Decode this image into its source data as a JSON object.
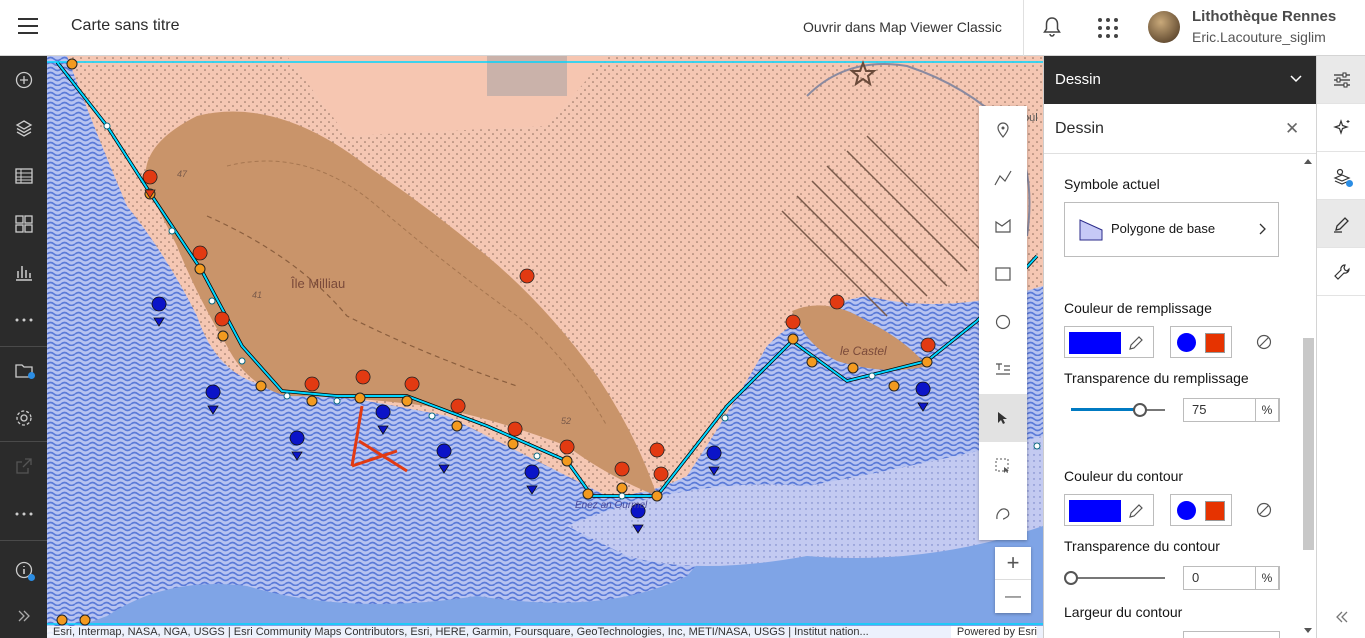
{
  "header": {
    "title": "Carte sans titre",
    "open_classic": "Ouvrir dans Map Viewer Classic",
    "user_name": "Lithothèque Rennes",
    "user_login": "Eric.Lacouture_siglim"
  },
  "left_toolbar": {
    "items": [
      "add-icon",
      "layers-icon",
      "table-icon",
      "basemap-icon",
      "chart-icon",
      "more-icon",
      "map-properties-icon",
      "settings-icon",
      "share-icon",
      "more-icon",
      "info-icon",
      "expand-icon"
    ]
  },
  "map": {
    "labels": {
      "island": "Île Milliau",
      "castel": "le Castel",
      "beach": "Enez an Ourmel",
      "elev1": "47",
      "elev2": "41",
      "elev3": "52",
      "top_right": "oul"
    },
    "attribution": "Esri, Intermap, NASA, NGA, USGS | Esri Community Maps Contributors, Esri, HERE, Garmin, Foursquare, GeoTechnologies, Inc, METI/NASA, USGS | Institut nation...",
    "powered_by": "Powered by Esri",
    "colors": {
      "water": "#7fa4e6",
      "land": "#f4c7b3",
      "relief": "#c9946a",
      "polygon_outline": "#00d5ff",
      "marker_red": "#e23a12",
      "marker_blue": "#0b14c8"
    }
  },
  "draw_toolbar": {
    "tools": [
      "point-icon",
      "polyline-icon",
      "polygon-icon",
      "rectangle-icon",
      "circle-icon",
      "text-icon",
      "select-icon",
      "lasso-select-icon",
      "freehand-icon"
    ],
    "active": "select-icon"
  },
  "zoom": {
    "in": "+",
    "out": "—"
  },
  "panel": {
    "header_title": "Dessin",
    "sub_title": "Dessin",
    "current_symbol_label": "Symbole actuel",
    "symbol_name": "Polygone de base",
    "fill_color_label": "Couleur de remplissage",
    "fill_transparency_label": "Transparence du remplissage",
    "fill_transparency_value": "75",
    "outline_color_label": "Couleur du contour",
    "outline_transparency_label": "Transparence du contour",
    "outline_transparency_value": "0",
    "outline_width_label": "Largeur du contour",
    "unit": "%",
    "fill_color": "#0000ff",
    "preset_colors": [
      "#0000ff",
      "#e63300"
    ]
  },
  "right_toolbar": {
    "items": [
      "properties-icon",
      "effects-icon",
      "styles-icon",
      "sketch-icon",
      "tools-icon",
      "collapse-icon"
    ],
    "active": "sketch-icon"
  }
}
